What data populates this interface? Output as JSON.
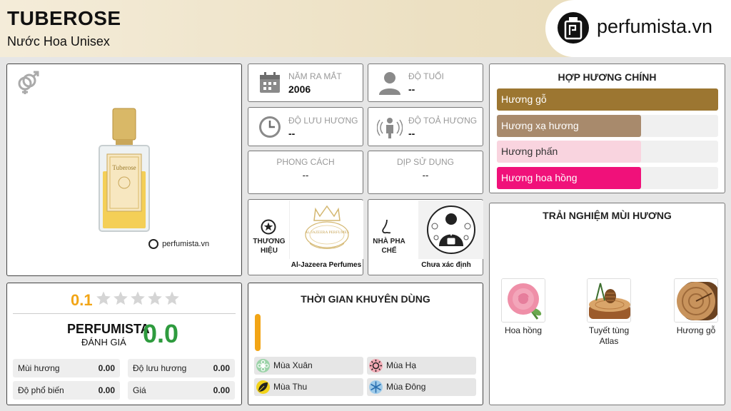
{
  "header": {
    "title": "TUBEROSE",
    "subtitle": "Nước Hoa Unisex",
    "brand_logo_text": "perfumista.vn"
  },
  "product": {
    "gender_icon": "unisex-gender-icon",
    "watermark": "perfumista.vn",
    "bottle_label": "Tuberose"
  },
  "stats": {
    "year": {
      "label": "NĂM RA MẮT",
      "value": "2006",
      "icon": "calendar-icon"
    },
    "age": {
      "label": "ĐỘ TUỔI",
      "value": "--",
      "icon": "person-icon"
    },
    "longevity": {
      "label": "ĐỘ LƯU HƯƠNG",
      "value": "--",
      "icon": "clock-icon"
    },
    "sillage": {
      "label": "ĐỘ TOẢ HƯƠNG",
      "value": "--",
      "icon": "radiating-person-icon"
    },
    "style": {
      "label": "PHONG CÁCH",
      "value": "--"
    },
    "occasion": {
      "label": "DỊP SỬ DỤNG",
      "value": "--"
    }
  },
  "brand": {
    "label": "THƯƠNG HIỆU",
    "name": "Al-Jazeera Perfumes",
    "logo_text": "AL JAZEERA PERFUMES"
  },
  "perfumer": {
    "label": "NHÀ PHA CHẾ",
    "name": "Chưa xác định"
  },
  "accords": {
    "title": "HỢP HƯƠNG CHÍNH",
    "items": [
      {
        "label": "Hương gỗ",
        "fill_percent": 100,
        "color": "#9c7631"
      },
      {
        "label": "Hương xạ hương",
        "fill_percent": 65,
        "color": "#a88a6c"
      },
      {
        "label": "Hương phấn",
        "fill_percent": 65,
        "color": "#f9d4df"
      },
      {
        "label": "Hương hoa hồng",
        "fill_percent": 65,
        "color": "#f0117a"
      }
    ]
  },
  "experience": {
    "title": "TRẢI NGHIỆM MÙI HƯƠNG",
    "items": [
      {
        "label": "Hoa hồng",
        "icon": "rose-icon"
      },
      {
        "label": "Tuyết tùng Atlas",
        "icon": "cedar-wood-icon"
      },
      {
        "label": "Hương gỗ",
        "icon": "wood-log-icon"
      }
    ]
  },
  "rating": {
    "score": "0.1",
    "stars_filled": 0,
    "stars_total": 5,
    "brand": "PERFUMISTA",
    "label": "ĐÁNH GIÁ",
    "value": "0.0",
    "value_color": "#2e9b3e",
    "metrics": [
      {
        "label": "Mùi hương",
        "value": "0.00"
      },
      {
        "label": "Độ lưu hương",
        "value": "0.00"
      },
      {
        "label": "Độ phổ biến",
        "value": "0.00"
      },
      {
        "label": "Giá",
        "value": "0.00"
      }
    ]
  },
  "seasons": {
    "title": "THỜI GIAN KHUYÊN DÙNG",
    "accent_color": "#f2a516",
    "items": [
      {
        "label": "Mùa Xuân",
        "icon": "flower-icon",
        "color": "#9bd3a8"
      },
      {
        "label": "Mùa Hạ",
        "icon": "sun-icon",
        "color": "#f3a9b4"
      },
      {
        "label": "Mùa Thu",
        "icon": "leaf-icon",
        "color": "#f2d31a"
      },
      {
        "label": "Mùa Đông",
        "icon": "snowflake-icon",
        "color": "#9ecbea"
      }
    ]
  }
}
